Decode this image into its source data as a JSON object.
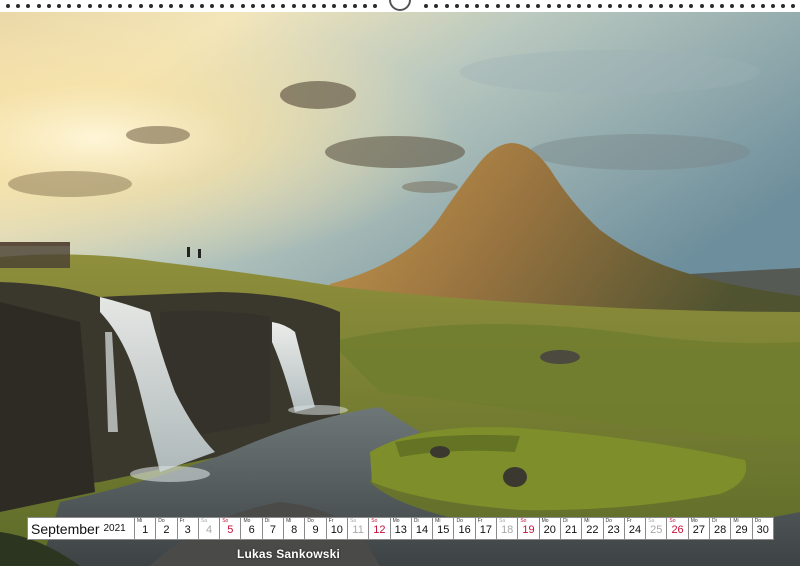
{
  "calendar": {
    "month": "September",
    "year": "2021",
    "days": [
      {
        "wd": "Mi",
        "n": "1"
      },
      {
        "wd": "Do",
        "n": "2"
      },
      {
        "wd": "Fr",
        "n": "3"
      },
      {
        "wd": "Sa",
        "n": "4"
      },
      {
        "wd": "So",
        "n": "5"
      },
      {
        "wd": "Mo",
        "n": "6"
      },
      {
        "wd": "Di",
        "n": "7"
      },
      {
        "wd": "Mi",
        "n": "8"
      },
      {
        "wd": "Do",
        "n": "9"
      },
      {
        "wd": "Fr",
        "n": "10"
      },
      {
        "wd": "Sa",
        "n": "11"
      },
      {
        "wd": "So",
        "n": "12"
      },
      {
        "wd": "Mo",
        "n": "13"
      },
      {
        "wd": "Di",
        "n": "14"
      },
      {
        "wd": "Mi",
        "n": "15"
      },
      {
        "wd": "Do",
        "n": "16"
      },
      {
        "wd": "Fr",
        "n": "17"
      },
      {
        "wd": "Sa",
        "n": "18"
      },
      {
        "wd": "So",
        "n": "19"
      },
      {
        "wd": "Mo",
        "n": "20"
      },
      {
        "wd": "Di",
        "n": "21"
      },
      {
        "wd": "Mi",
        "n": "22"
      },
      {
        "wd": "Do",
        "n": "23"
      },
      {
        "wd": "Fr",
        "n": "24"
      },
      {
        "wd": "Sa",
        "n": "25"
      },
      {
        "wd": "So",
        "n": "26"
      },
      {
        "wd": "Mo",
        "n": "27"
      },
      {
        "wd": "Di",
        "n": "28"
      },
      {
        "wd": "Mi",
        "n": "29"
      },
      {
        "wd": "Do",
        "n": "30"
      }
    ]
  },
  "credit": "Lukas Sankowski",
  "colors": {
    "sunday": "#c4123a",
    "saturday": "#a8a8a8"
  }
}
